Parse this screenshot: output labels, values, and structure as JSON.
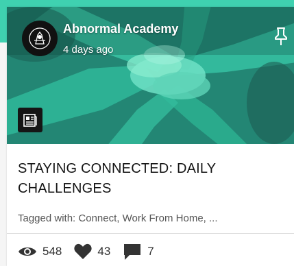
{
  "post": {
    "author": "Abnormal Academy",
    "time_ago": "4 days ago",
    "title": "STAYING CONNECTED: DAILY CHALLENGES",
    "tags": "Tagged with: Connect, Work From Home, ...",
    "views": "548",
    "likes": "43",
    "comments": "7"
  },
  "icons": {
    "pin": "pin-icon",
    "document": "document-icon",
    "views": "eye-icon",
    "likes": "heart-icon",
    "comments": "comment-icon"
  },
  "colors": {
    "accent": "#3fd1b0",
    "overlay": "#1e6f63"
  }
}
